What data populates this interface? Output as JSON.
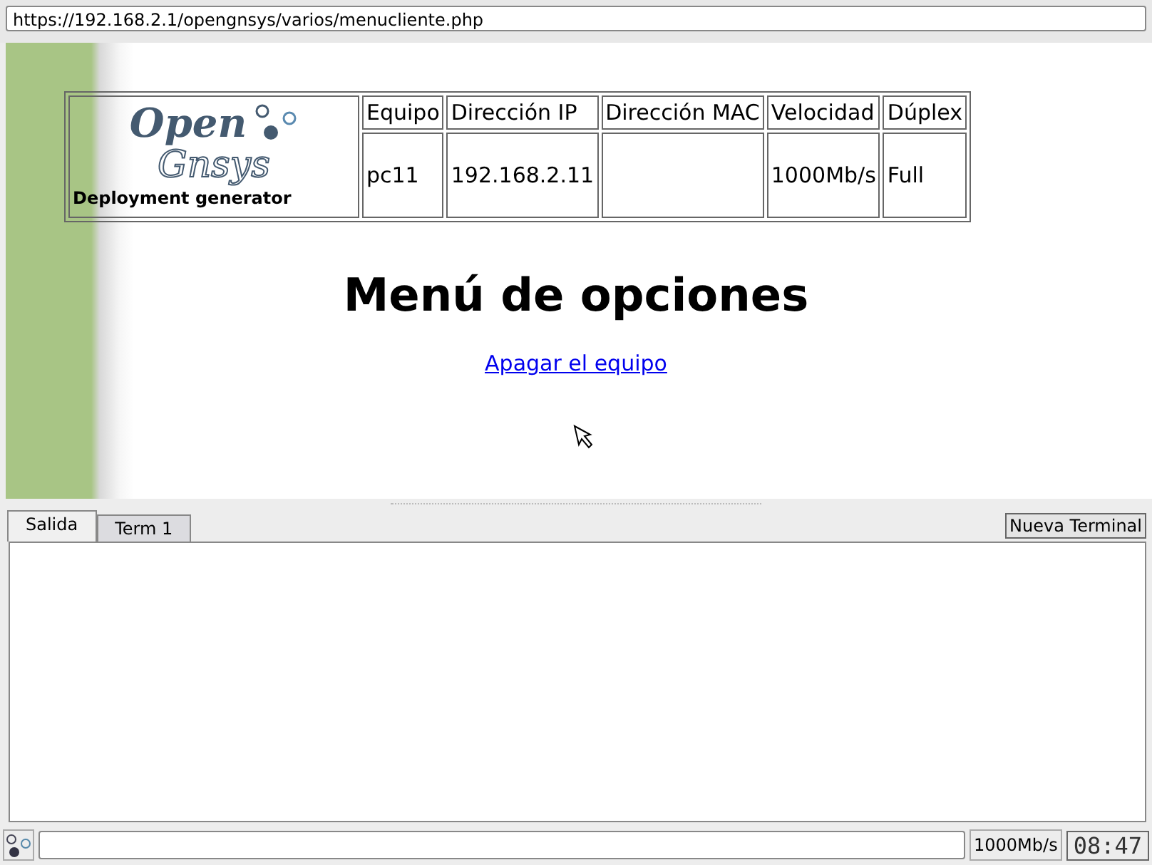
{
  "address_bar": {
    "url": "https://192.168.2.1/opengnsys/varios/menucliente.php"
  },
  "header": {
    "logo": {
      "line_1": "Open",
      "line_2": "Gnsys",
      "tagline": "Deployment generator"
    },
    "fields": [
      {
        "label": "Equipo",
        "value": "pc11"
      },
      {
        "label": "Dirección IP",
        "value": "192.168.2.11"
      },
      {
        "label": "Dirección MAC"
      },
      {
        "label": "Velocidad",
        "value": "1000Mb/s"
      },
      {
        "label": "Dúplex",
        "value": "Full"
      }
    ]
  },
  "title": "Menú de opciones",
  "links": [
    "Apagar el equipo"
  ],
  "tabs": [
    {
      "label": "Salida",
      "selected": true
    },
    {
      "label": "Term 1",
      "selected": false
    }
  ],
  "new_terminal_button": "Nueva Terminal",
  "status_bar": {
    "speed": "1000Mb/s",
    "clock": "08:47"
  }
}
